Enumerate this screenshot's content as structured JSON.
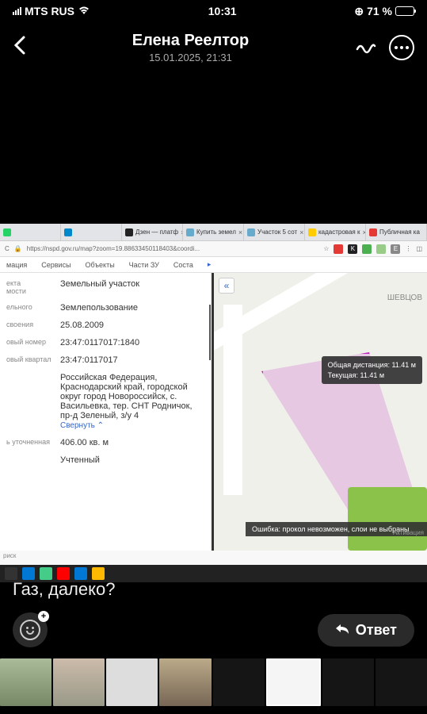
{
  "status": {
    "carrier": "MTS RUS",
    "time": "10:31",
    "battery_pct": "71 %"
  },
  "header": {
    "contact_name": "Елена Реелтор",
    "timestamp": "15.01.2025, 21:31"
  },
  "browser": {
    "tabs": [
      {
        "label": "",
        "color": "#25d366"
      },
      {
        "label": "",
        "color": "#0088cc"
      },
      {
        "label": "Дзен — платф",
        "color": "#222"
      },
      {
        "label": "Купить земел",
        "color": "#6ac"
      },
      {
        "label": "Участок 5 сот",
        "color": "#6ac"
      },
      {
        "label": "кадастровая к",
        "color": "#ff0000"
      },
      {
        "label": "Публичная ка",
        "color": "#e53935"
      }
    ],
    "url": "https://nspd.gov.ru/map?zoom=19.88633450118403&coordi...",
    "menu": [
      "мация",
      "Сервисы",
      "Объекты",
      "Части ЗУ",
      "Соста"
    ],
    "info": {
      "type_label": "екта",
      "type_label2": "мости",
      "type_value": "Земельный участок",
      "use_label": "ельного",
      "use_value": "Землепользование",
      "date_label": "своения",
      "date_value": "25.08.2009",
      "cadnum_label": "овый номер",
      "cadnum_value": "23:47:0117017:1840",
      "quarter_label": "овый квартал",
      "quarter_value": "23:47:0117017",
      "address": "Российская Федерация, Краснодарский край, городской округ город Новороссийск, с. Васильевка, тер. СНТ Родничок, пр-д Зеленый, з/у 4",
      "collapse": "Свернуть",
      "area_label": "ь уточненная",
      "area_value": "406.00 кв. м",
      "status_value": "Учтенный"
    },
    "map": {
      "region": "ШЕВЦОВ",
      "tooltip_dist": "Общая дистанция: 11.41 м",
      "tooltip_cur": "Текущая: 11.41 м",
      "error": "Ошибка: прокол невозможен, слои не выбраны",
      "activation": "Активация"
    },
    "search_placeholder": "риск"
  },
  "chat": {
    "message": "Газ, далеко?",
    "reply_label": "Ответ"
  }
}
